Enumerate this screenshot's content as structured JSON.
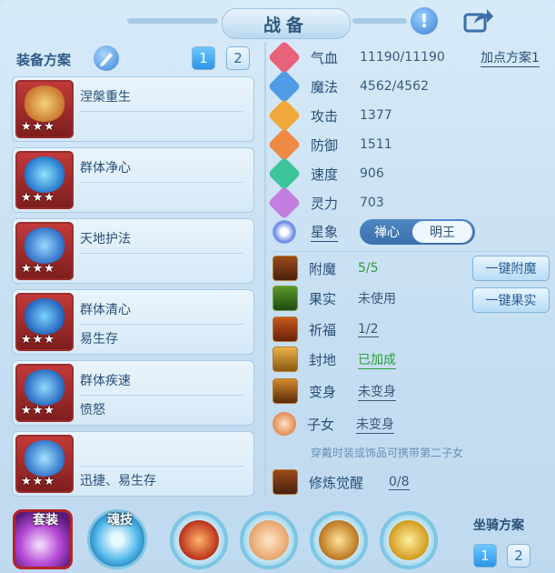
{
  "title": "战备",
  "equip_scheme": {
    "label": "装备方案",
    "tabs": [
      "1",
      "2"
    ],
    "active_tab": "1"
  },
  "equip_cards": [
    {
      "name": "涅槃重生",
      "sub": "",
      "stars": "★★★"
    },
    {
      "name": "群体净心",
      "sub": "",
      "stars": "★★★"
    },
    {
      "name": "天地护法",
      "sub": "",
      "stars": "★★★"
    },
    {
      "name": "群体清心",
      "sub": "易生存",
      "stars": "★★★"
    },
    {
      "name": "群体疾速",
      "sub": "愤怒",
      "stars": "★★★"
    },
    {
      "name": "",
      "sub": "迅捷、易生存",
      "stars": "★★★"
    }
  ],
  "stats": [
    {
      "label": "气血",
      "value": "11190/11190",
      "icon": "heart-icon",
      "color": "#e8627a"
    },
    {
      "label": "魔法",
      "value": "4562/4562",
      "icon": "magic-icon",
      "color": "#4f9be6"
    },
    {
      "label": "攻击",
      "value": "1377",
      "icon": "sword-icon",
      "color": "#f0a83a"
    },
    {
      "label": "防御",
      "value": "1511",
      "icon": "shield-icon",
      "color": "#ef8a45"
    },
    {
      "label": "速度",
      "value": "906",
      "icon": "lightning-icon",
      "color": "#3cc59a"
    },
    {
      "label": "灵力",
      "value": "703",
      "icon": "spirit-icon",
      "color": "#c27fe0"
    }
  ],
  "add_point_plan": "加点方案1",
  "star_sign": {
    "label": "星象",
    "options": [
      "禅心",
      "明王"
    ],
    "selected": "明王"
  },
  "extras": [
    {
      "label": "附魔",
      "value": "5/5",
      "value_color": "#2e9e3a",
      "underline": false
    },
    {
      "label": "果实",
      "value": "未使用",
      "value_color": "#3a5a7a",
      "underline": false
    },
    {
      "label": "祈福",
      "value": "1/2",
      "value_color": "#3a5a7a",
      "underline": true
    },
    {
      "label": "封地",
      "value": "已加成",
      "value_color": "#2e9e3a",
      "underline": true
    },
    {
      "label": "变身",
      "value": "未变身",
      "value_color": "#3a5a7a",
      "underline": true
    },
    {
      "label": "子女",
      "value": "未变身",
      "value_color": "#3a5a7a",
      "underline": true
    }
  ],
  "buttons": {
    "enchant": "一键附魔",
    "fruit": "一键果实"
  },
  "child_note": "穿戴时装或饰品可携带第二子女",
  "cultivation": {
    "label": "修炼觉醒",
    "value": "0/8"
  },
  "bottom": {
    "suit_label": "套装",
    "soul_skill_label": "魂技",
    "mount_scheme_label": "坐骑方案",
    "mount_tabs": [
      "1",
      "2"
    ],
    "active_mount_tab": "1"
  }
}
